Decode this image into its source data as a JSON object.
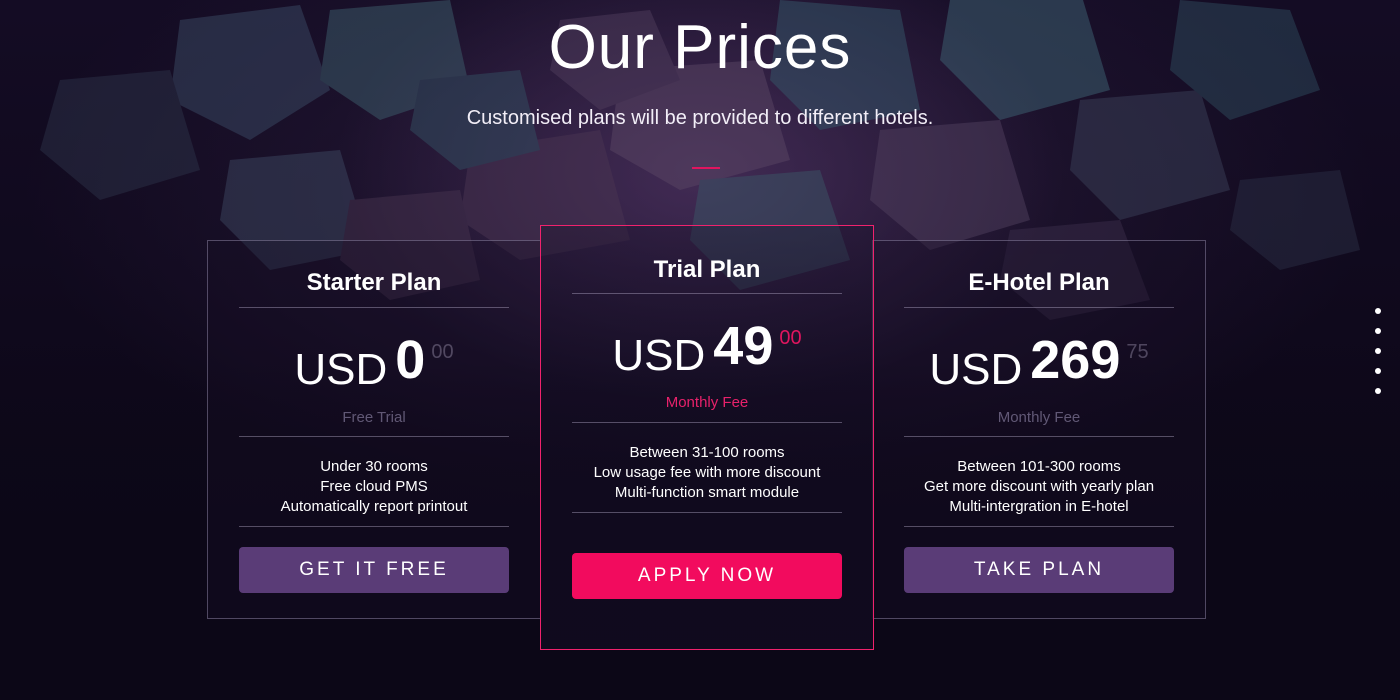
{
  "section": {
    "title": "Our Prices",
    "subtitle": "Customised plans will be provided to different hotels."
  },
  "plans": [
    {
      "name": "Starter Plan",
      "currency": "USD",
      "amount": "0",
      "cents": "00",
      "fee_label": "Free Trial",
      "features": [
        "Under 30 rooms",
        "Free cloud PMS",
        "Automatically report printout"
      ],
      "button_label": "GET IT FREE"
    },
    {
      "name": "Trial Plan",
      "currency": "USD",
      "amount": "49",
      "cents": "00",
      "fee_label": "Monthly Fee",
      "features": [
        "Between 31-100 rooms",
        "Low usage fee with more discount",
        "Multi-function smart module"
      ],
      "button_label": "APPLY NOW"
    },
    {
      "name": "E-Hotel Plan",
      "currency": "USD",
      "amount": "269",
      "cents": "75",
      "fee_label": "Monthly Fee",
      "features": [
        "Between 101-300 rooms",
        "Get more discount with yearly plan",
        "Multi-intergration in E-hotel"
      ],
      "button_label": "TAKE PLAN"
    }
  ],
  "page_nav": {
    "dot_count": 5
  },
  "colors": {
    "accent": "#f20b5e",
    "button_secondary": "#5a3c77",
    "background": "#0c0717"
  }
}
